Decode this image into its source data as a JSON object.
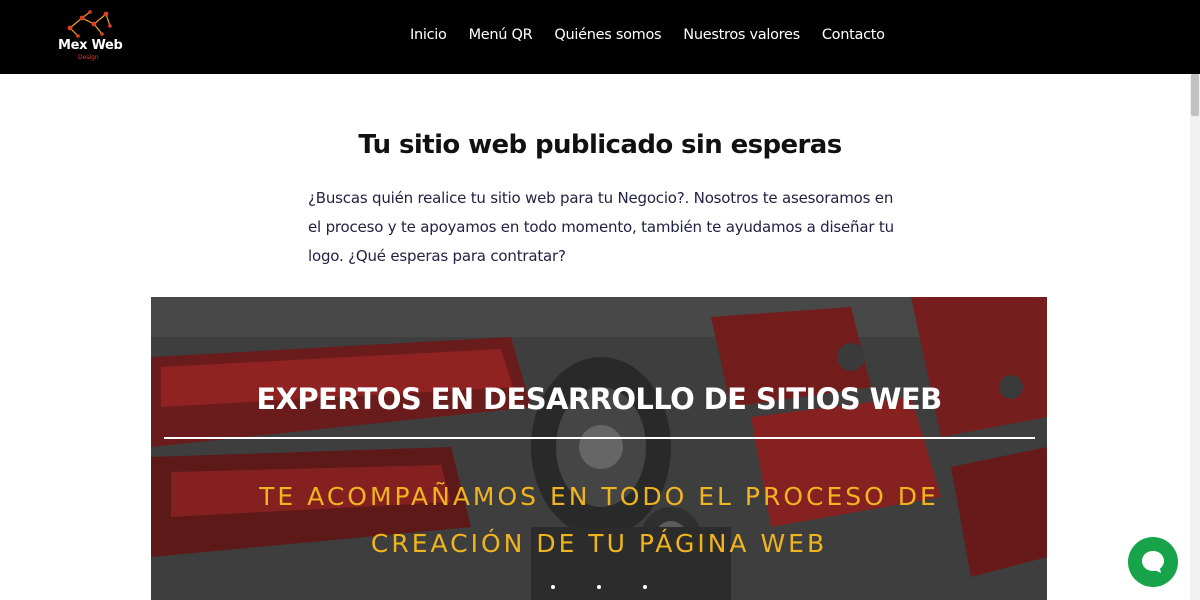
{
  "brand": {
    "name": "Mex Web",
    "tagline": "Design",
    "accent_color": "#e0402a"
  },
  "nav": {
    "items": [
      {
        "label": "Inicio"
      },
      {
        "label": "Menú QR"
      },
      {
        "label": "Quiénes somos"
      },
      {
        "label": "Nuestros valores"
      },
      {
        "label": "Contacto"
      }
    ]
  },
  "intro": {
    "title": "Tu sitio web publicado sin esperas",
    "text": "¿Buscas quién realice tu sitio web para tu Negocio?. Nosotros te asesoramos en el proceso y te apoyamos en todo momento, también te ayudamos a diseñar tu logo. ¿Qué esperas para contratar?"
  },
  "hero": {
    "title": "EXPERTOS EN DESARROLLO DE SITIOS WEB",
    "subtitle_line1": "TE ACOMPAÑAMOS EN TODO EL PROCESO DE",
    "subtitle_line2": "CREACIÓN DE TU PÁGINA WEB",
    "subtitle_color": "#f0b41e",
    "slide_count": 3
  },
  "chat": {
    "icon": "chat-bubble-icon",
    "color": "#16a34a"
  }
}
